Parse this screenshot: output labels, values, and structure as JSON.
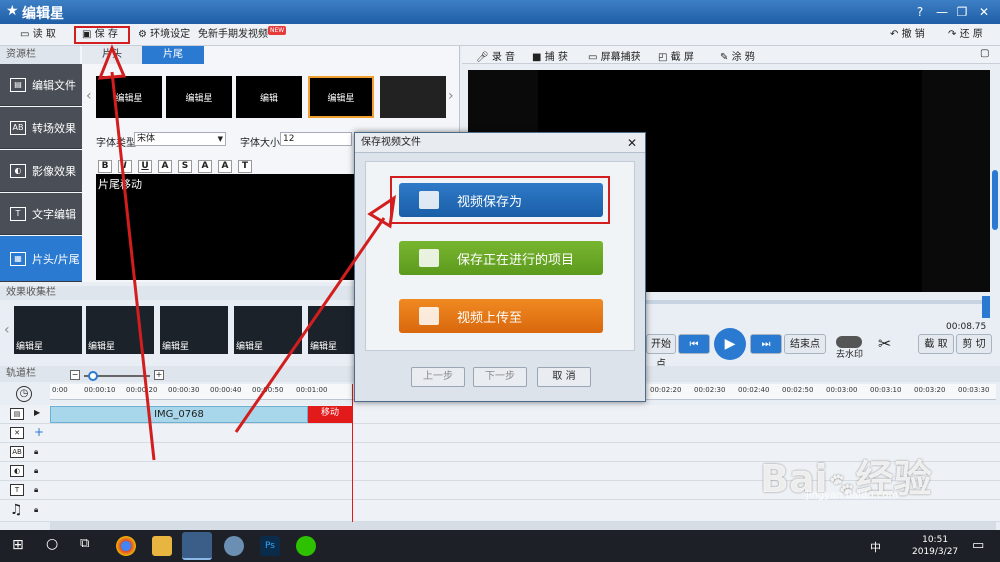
{
  "app": {
    "title": "编辑星"
  },
  "window_controls": {
    "help": "?",
    "minimize": "—",
    "restore": "❐",
    "close": "✕"
  },
  "toolbar": {
    "read": "读 取",
    "save": "保 存",
    "env_settings": "环境设定",
    "promo": "免新手期发视频",
    "new_badge": "NEW",
    "undo": "撤 销",
    "redo": "还 原"
  },
  "left_panel": {
    "header": "资源栏",
    "tabs": [
      "片头",
      "片尾"
    ],
    "sidebar": [
      "编辑文件",
      "转场效果",
      "影像效果",
      "文字编辑",
      "片头/片尾"
    ],
    "thumbnails": [
      "编辑星",
      "编辑星",
      "编辑",
      "编辑星",
      ""
    ],
    "font_type_label": "字体类型",
    "font_type_value": "宋体",
    "font_size_label": "字体大小",
    "font_size_value": "12",
    "format_buttons": [
      "B",
      "I",
      "U",
      "A",
      "S",
      "A",
      "A",
      "T"
    ],
    "text_content": "片尾移动"
  },
  "right_toolbar": {
    "record": "录 音",
    "capture": "捕 获",
    "screen_capture": "屏幕捕获",
    "screenshot": "截 屏",
    "paint": "涂 鸦"
  },
  "player": {
    "time": "00:08.75",
    "start_point": "开始点",
    "end_point": "结束点",
    "remove_watermark": "去水印",
    "trim": "截 取",
    "cut": "剪 切"
  },
  "effects": {
    "header": "效果收集栏",
    "items": [
      "编辑星",
      "编辑星",
      "编辑星",
      "编辑星",
      "编辑星"
    ]
  },
  "timeline": {
    "header": "轨道栏",
    "ruler": [
      "0:00",
      "00:00:10",
      "00:00:20",
      "00:00:30",
      "00:00:40",
      "00:00:50",
      "00:01:00",
      "00:02:20",
      "00:02:30",
      "00:02:40",
      "00:02:50",
      "00:03:00",
      "00:03:10",
      "00:03:20",
      "00:03:30"
    ],
    "clip_name": "IMG_0768",
    "clip2_name": "移动"
  },
  "dialog": {
    "title": "保存视频文件",
    "close": "✕",
    "save_as": "视频保存为",
    "save_project": "保存正在进行的项目",
    "upload": "视频上传至",
    "prev": "上一步",
    "next": "下一步",
    "cancel": "取 消"
  },
  "taskbar": {
    "time": "10:51",
    "date": "2019/3/27",
    "lang": "中"
  },
  "watermark": {
    "brand": "Bai",
    "brand2": "经验",
    "url": "jingyan.baidu.com"
  },
  "colors": {
    "accent": "#2a7ad1",
    "annotation": "#d21e1e",
    "green": "#6aa826",
    "orange": "#e57a17"
  }
}
